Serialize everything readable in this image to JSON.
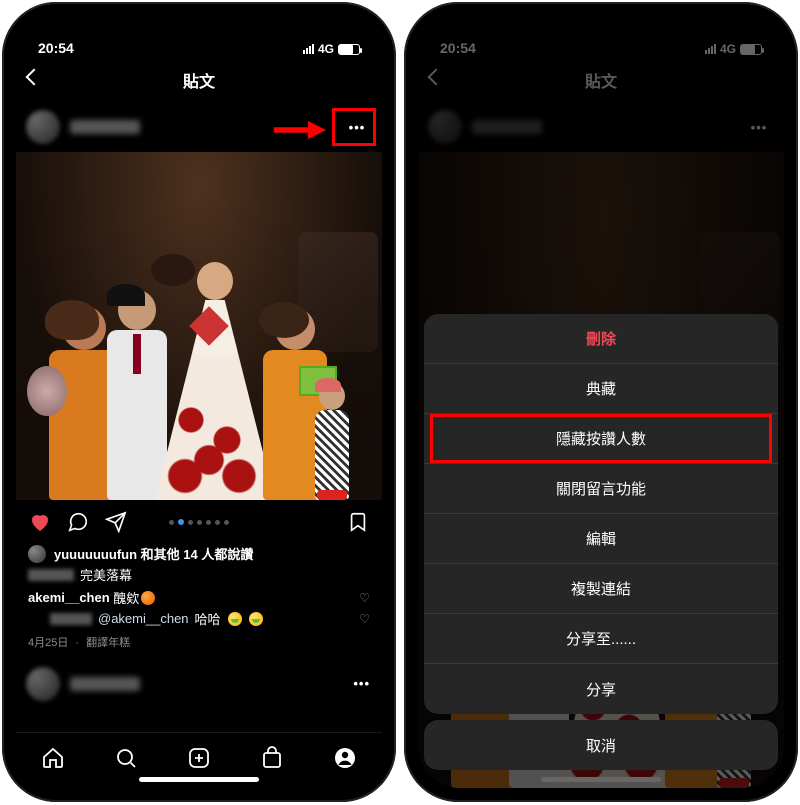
{
  "status": {
    "time": "20:54",
    "network": "4G"
  },
  "nav": {
    "title": "貼文"
  },
  "post": {
    "likes_text": "yuuuuuuufun 和其他 14 人都說讚",
    "caption": "完美落幕",
    "comment_user": "akemi__chen",
    "comment_text": "醜欸",
    "reply_mention": "@akemi__chen",
    "reply_text": "哈哈",
    "date": "4月25日",
    "translate": "翻譯年糕"
  },
  "sheet": {
    "delete": "刪除",
    "archive": "典藏",
    "hide_likes": "隱藏按讚人數",
    "close_comments": "關閉留言功能",
    "edit": "編輯",
    "copy_link": "複製連結",
    "share_to": "分享至......",
    "share": "分享",
    "cancel": "取消"
  }
}
